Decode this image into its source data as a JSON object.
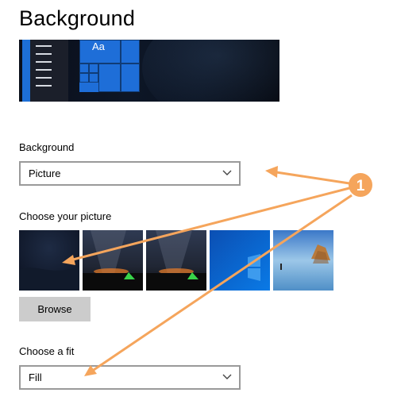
{
  "page": {
    "title": "Background"
  },
  "preview": {
    "tile_text": "Aa"
  },
  "background_section": {
    "label": "Background",
    "selected": "Picture"
  },
  "picture_section": {
    "label": "Choose your picture",
    "thumbnails": [
      "dark-blue-abstract",
      "milky-way-tent-1",
      "milky-way-tent-2",
      "windows-blue",
      "beach-rocks"
    ],
    "browse_label": "Browse"
  },
  "fit_section": {
    "label": "Choose a fit",
    "selected": "Fill"
  },
  "annotation": {
    "marker": "1",
    "color": "#f5a55c"
  }
}
